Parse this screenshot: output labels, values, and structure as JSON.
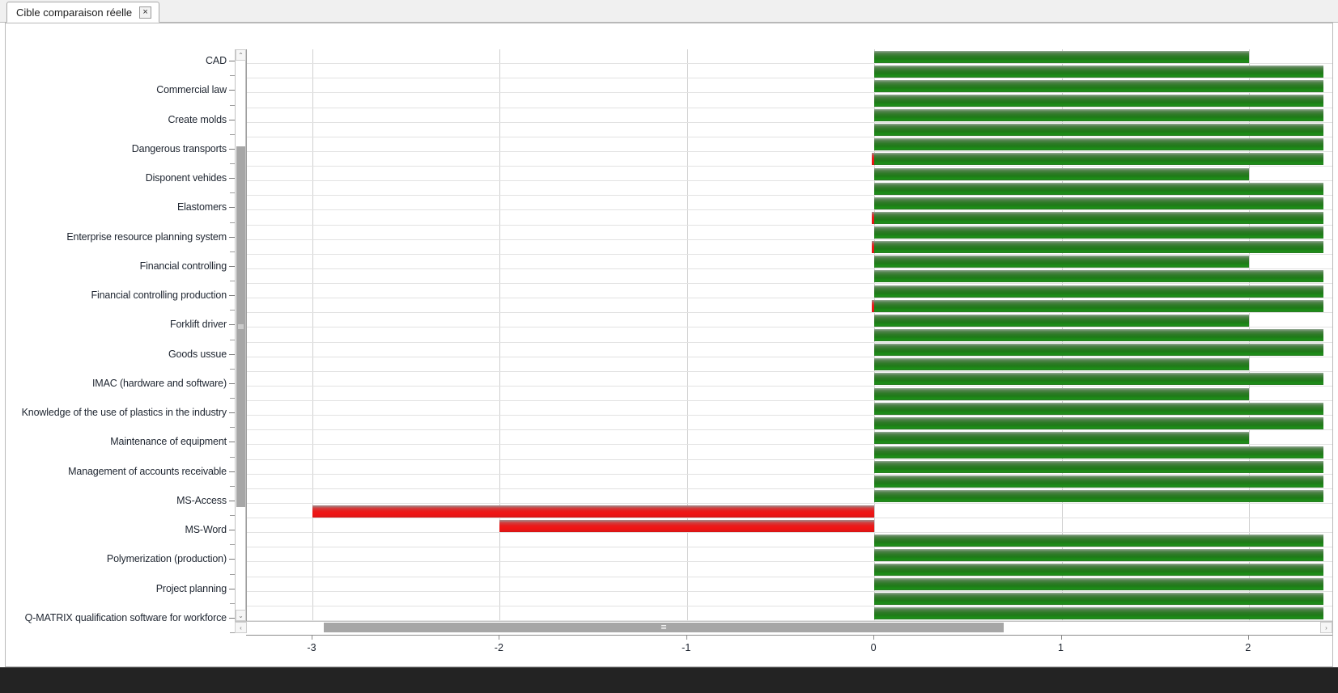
{
  "window": {
    "tab": {
      "label": "Cible comparaison réelle",
      "close_label": "×",
      "close_icon": "close-icon"
    }
  },
  "scrollbars": {
    "vertical": {
      "up_glyph": "⌃",
      "down_glyph": "⌄"
    },
    "horizontal": {
      "left_glyph": "‹",
      "right_glyph": "›"
    }
  },
  "chart_data": {
    "type": "bar",
    "orientation": "horizontal",
    "title": "",
    "xlabel": "",
    "ylabel": "",
    "xlim": [
      -3.35,
      2.45
    ],
    "xticks": [
      -3,
      -2,
      -1,
      0,
      1,
      2
    ],
    "xtick_labels": [
      "-3",
      "-2",
      "-1",
      "0",
      "1",
      "2"
    ],
    "grid": true,
    "legend": "none",
    "colors": {
      "positive": "#1f7a18",
      "negative": "#e81c1c",
      "grid": "#cfcfcf",
      "axis": "#8b8b8b"
    },
    "categories": [
      "CAD",
      "Commercial law",
      "Create molds",
      "Dangerous transports",
      "Disponent vehides",
      "Elastomers",
      "Enterprise resource planning system",
      "Financial controlling",
      "Financial controlling production",
      "Forklift driver",
      "Goods ussue",
      "IMAC (hardware and software)",
      "Knowledge of the use of plastics in the industry",
      "Maintenance of equipment",
      "Management of accounts receivable",
      "MS-Access",
      "MS-Word",
      "Polymerization (production)",
      "Project planning",
      "Q-MATRIX qualification software for workforce"
    ],
    "series": [
      {
        "name": "Cible",
        "values": [
          2.0,
          2.4,
          2.4,
          2.4,
          2.0,
          2.4,
          2.4,
          2.0,
          2.4,
          2.0,
          2.4,
          2.0,
          2.4,
          2.0,
          2.4,
          2.4,
          2.4,
          2.4,
          2.4,
          2.4
        ]
      },
      {
        "name": "Réelle",
        "values": [
          2.4,
          2.4,
          2.4,
          2.4,
          2.4,
          2.4,
          2.4,
          2.4,
          2.4,
          2.4,
          2.4,
          2.4,
          2.4,
          2.4,
          2.4,
          -3.0,
          -2.0,
          2.4,
          2.4,
          2.4
        ]
      }
    ],
    "bars": [
      {
        "row": 0,
        "category": "CAD",
        "value": 2.0,
        "sign": "positive"
      },
      {
        "row": 1,
        "category": "CAD",
        "value": 2.4,
        "sign": "positive"
      },
      {
        "row": 2,
        "category": "Commercial law",
        "value": 2.4,
        "sign": "positive"
      },
      {
        "row": 3,
        "category": "Commercial law",
        "value": 2.4,
        "sign": "positive"
      },
      {
        "row": 4,
        "category": "Create molds",
        "value": 2.4,
        "sign": "positive"
      },
      {
        "row": 5,
        "category": "Create molds",
        "value": 2.4,
        "sign": "positive"
      },
      {
        "row": 6,
        "category": "Dangerous transports",
        "value": 2.4,
        "sign": "positive"
      },
      {
        "row": 7,
        "category": "Dangerous transports",
        "value": 2.4,
        "sign": "positive",
        "stub_negative": true
      },
      {
        "row": 8,
        "category": "Disponent vehides",
        "value": 2.0,
        "sign": "positive"
      },
      {
        "row": 9,
        "category": "Disponent vehides",
        "value": 2.4,
        "sign": "positive"
      },
      {
        "row": 10,
        "category": "Elastomers",
        "value": 2.4,
        "sign": "positive"
      },
      {
        "row": 11,
        "category": "Elastomers",
        "value": 2.4,
        "sign": "positive",
        "stub_negative": true
      },
      {
        "row": 12,
        "category": "Enterprise resource planning system",
        "value": 2.4,
        "sign": "positive"
      },
      {
        "row": 13,
        "category": "Enterprise resource planning system",
        "value": 2.4,
        "sign": "positive",
        "stub_negative": true
      },
      {
        "row": 14,
        "category": "Financial controlling",
        "value": 2.0,
        "sign": "positive"
      },
      {
        "row": 15,
        "category": "Financial controlling",
        "value": 2.4,
        "sign": "positive"
      },
      {
        "row": 16,
        "category": "Financial controlling production",
        "value": 2.4,
        "sign": "positive"
      },
      {
        "row": 17,
        "category": "Financial controlling production",
        "value": 2.4,
        "sign": "positive",
        "stub_negative": true
      },
      {
        "row": 18,
        "category": "Forklift driver",
        "value": 2.0,
        "sign": "positive"
      },
      {
        "row": 19,
        "category": "Forklift driver",
        "value": 2.4,
        "sign": "positive"
      },
      {
        "row": 20,
        "category": "Goods ussue",
        "value": 2.4,
        "sign": "positive"
      },
      {
        "row": 21,
        "category": "Goods ussue",
        "value": 2.0,
        "sign": "positive"
      },
      {
        "row": 22,
        "category": "IMAC (hardware and software)",
        "value": 2.4,
        "sign": "positive"
      },
      {
        "row": 23,
        "category": "IMAC (hardware and software)",
        "value": 2.0,
        "sign": "positive"
      },
      {
        "row": 24,
        "category": "Knowledge of the use of plastics in the industry",
        "value": 2.4,
        "sign": "positive"
      },
      {
        "row": 25,
        "category": "Knowledge of the use of plastics in the industry",
        "value": 2.4,
        "sign": "positive"
      },
      {
        "row": 26,
        "category": "Maintenance of equipment",
        "value": 2.0,
        "sign": "positive"
      },
      {
        "row": 27,
        "category": "Maintenance of equipment",
        "value": 2.4,
        "sign": "positive"
      },
      {
        "row": 28,
        "category": "Management of accounts receivable",
        "value": 2.4,
        "sign": "positive"
      },
      {
        "row": 29,
        "category": "Management of accounts receivable",
        "value": 2.4,
        "sign": "positive"
      },
      {
        "row": 30,
        "category": "MS-Access",
        "value": 2.4,
        "sign": "positive"
      },
      {
        "row": 31,
        "category": "MS-Access",
        "value": -3.0,
        "sign": "negative"
      },
      {
        "row": 32,
        "category": "MS-Word",
        "value": -2.0,
        "sign": "negative"
      },
      {
        "row": 33,
        "category": "MS-Word",
        "value": 2.4,
        "sign": "positive"
      },
      {
        "row": 34,
        "category": "Polymerization (production)",
        "value": 2.4,
        "sign": "positive"
      },
      {
        "row": 35,
        "category": "Polymerization (production)",
        "value": 2.4,
        "sign": "positive"
      },
      {
        "row": 36,
        "category": "Project planning",
        "value": 2.4,
        "sign": "positive"
      },
      {
        "row": 37,
        "category": "Project planning",
        "value": 2.4,
        "sign": "positive"
      },
      {
        "row": 38,
        "category": "Q-MATRIX qualification software for workforce",
        "value": 2.4,
        "sign": "positive"
      }
    ]
  }
}
